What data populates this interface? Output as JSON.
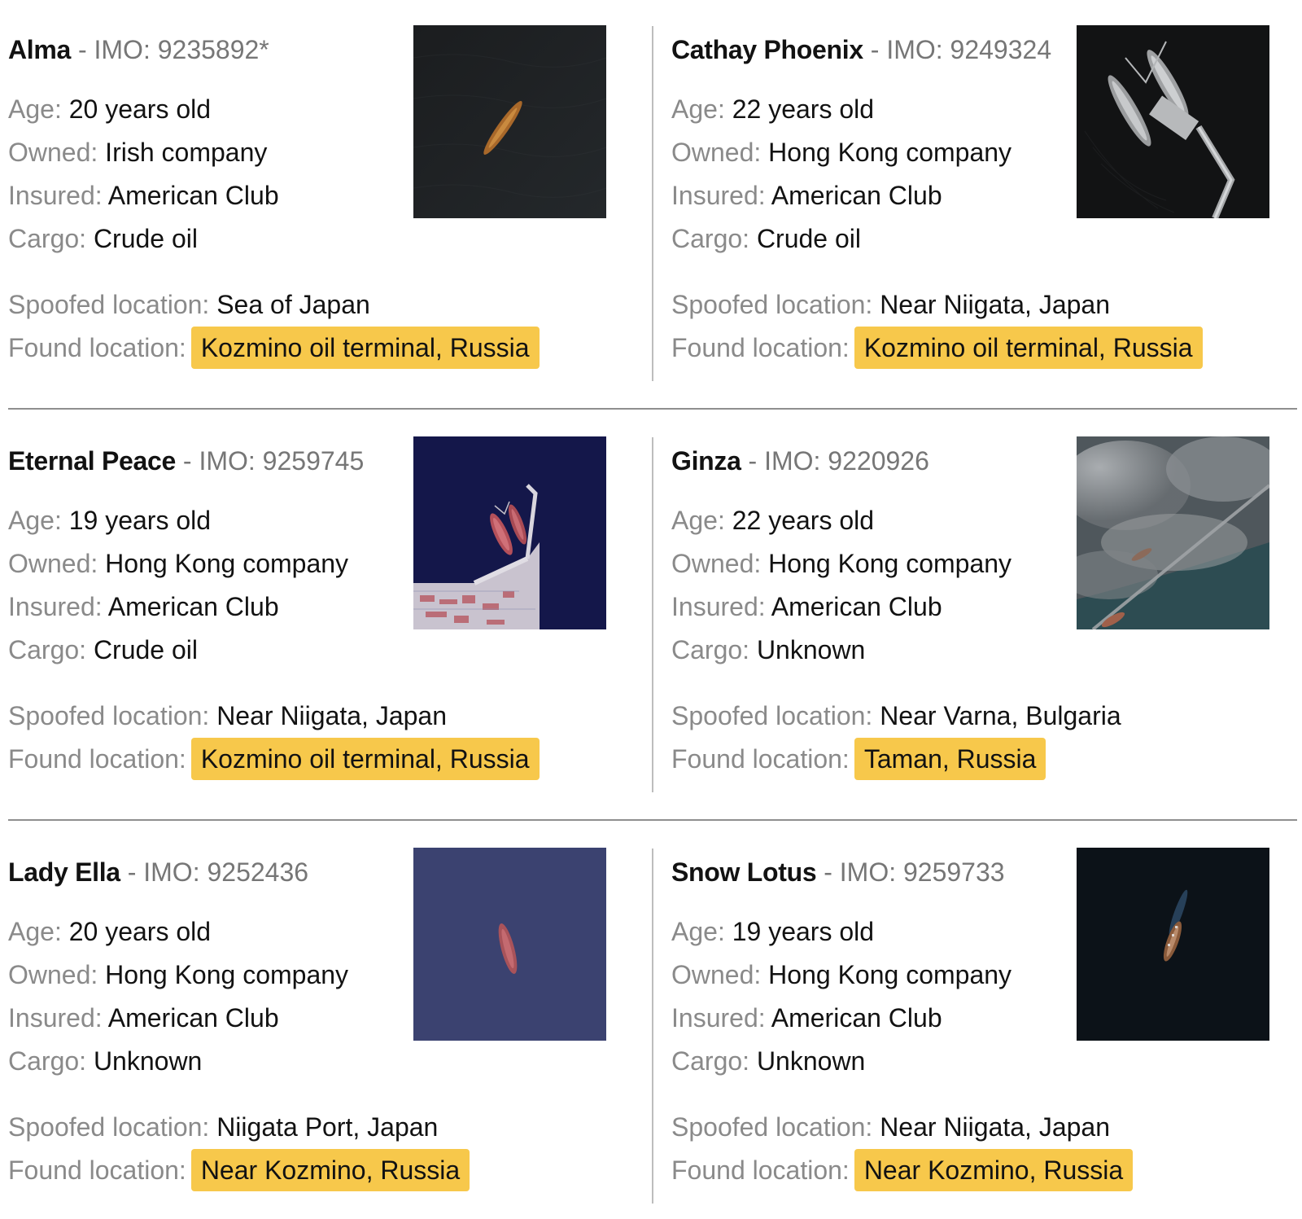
{
  "labels": {
    "imo_prefix": "IMO:",
    "sep": " - ",
    "age": "Age:",
    "owned": "Owned:",
    "insured": "Insured:",
    "cargo": "Cargo:",
    "spoofed": "Spoofed location:",
    "found": "Found location:"
  },
  "colors": {
    "highlight": "#f7c84b",
    "label_gray": "#8a8a8a",
    "separator": "#8f8f8f"
  },
  "vessels": [
    {
      "name": "Alma",
      "imo": "9235892*",
      "age": "20 years old",
      "owned": "Irish company",
      "insured": "American Club",
      "cargo": "Crude oil",
      "spoofed": "Sea of Japan",
      "found": "Kozmino oil terminal, Russia",
      "image": "satellite-tanker-open-sea"
    },
    {
      "name": "Cathay Phoenix",
      "imo": "9249324",
      "age": "22 years old",
      "owned": "Hong Kong company",
      "insured": "American Club",
      "cargo": "Crude oil",
      "spoofed": "Near Niigata, Japan",
      "found": "Kozmino oil terminal, Russia",
      "image": "satellite-tankers-at-pier"
    },
    {
      "name": "Eternal Peace",
      "imo": "9259745",
      "age": "19 years old",
      "owned": "Hong Kong company",
      "insured": "American Club",
      "cargo": "Crude oil",
      "spoofed": "Near Niigata, Japan",
      "found": "Kozmino oil terminal, Russia",
      "image": "satellite-tankers-at-terminal"
    },
    {
      "name": "Ginza",
      "imo": "9220926",
      "age": "22 years old",
      "owned": "Hong Kong company",
      "insured": "American Club",
      "cargo": "Unknown",
      "spoofed": "Near Varna, Bulgaria",
      "found": "Taman, Russia",
      "image": "satellite-cloudy-jetty"
    },
    {
      "name": "Lady Ella",
      "imo": "9252436",
      "age": "20 years old",
      "owned": "Hong Kong company",
      "insured": "American Club",
      "cargo": "Unknown",
      "spoofed": "Niigata Port, Japan",
      "found": "Near Kozmino, Russia",
      "image": "satellite-tanker-blue-sea"
    },
    {
      "name": "Snow Lotus",
      "imo": "9259733",
      "age": "19 years old",
      "owned": "Hong Kong company",
      "insured": "American Club",
      "cargo": "Unknown",
      "spoofed": "Near Niigata, Japan",
      "found": "Near Kozmino, Russia",
      "image": "satellite-tanker-dark-sea"
    }
  ]
}
